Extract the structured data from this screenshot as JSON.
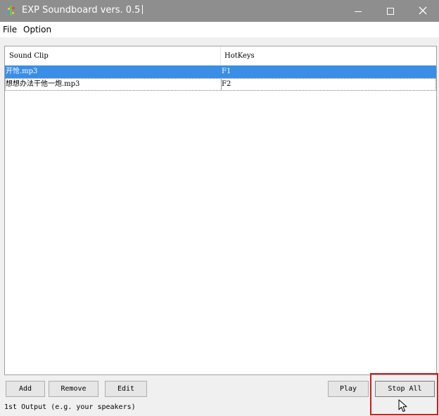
{
  "window": {
    "title": "EXP Soundboard vers. 0.5",
    "minimize_icon": "minimize-icon",
    "maximize_icon": "maximize-icon",
    "close_icon": "close-icon"
  },
  "menu": {
    "items": [
      {
        "label": "File"
      },
      {
        "label": "Option"
      }
    ]
  },
  "table": {
    "columns": [
      "Sound Clip",
      "HotKeys"
    ],
    "rows": [
      {
        "clip": "开怆.mp3",
        "hotkey": "F1",
        "selected": true
      },
      {
        "clip": "想想办法干他一炮.mp3",
        "hotkey": "F2",
        "selected": false
      }
    ]
  },
  "buttons": {
    "add": "Add",
    "remove": "Remove",
    "edit": "Edit",
    "play": "Play",
    "stop_all": "Stop All"
  },
  "status": {
    "output_label": "1st Output (e.g. your speakers)"
  },
  "colors": {
    "titlebar": "#8e8e8e",
    "selection": "#3a8ee6",
    "highlight_box": "#d01e1e"
  }
}
